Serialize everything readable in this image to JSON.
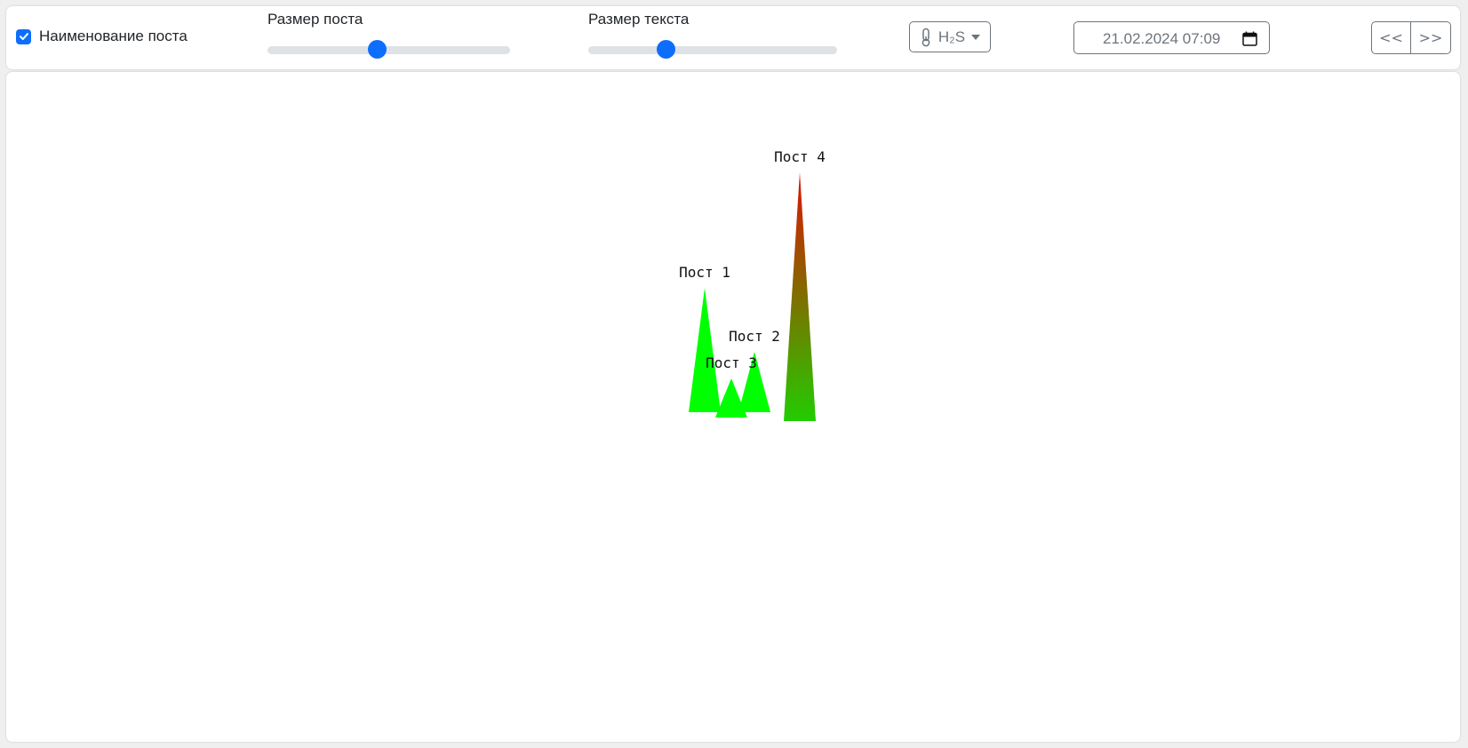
{
  "toolbar": {
    "show_names": {
      "label": "Наименование поста",
      "checked": true
    },
    "post_size": {
      "label": "Размер поста",
      "value_fraction": 0.45
    },
    "text_size": {
      "label": "Размер текста",
      "value_fraction": 0.31
    },
    "substance": {
      "icon": "thermometer-icon",
      "label": "H₂S"
    },
    "datetime": {
      "value": "21.02.2024 07:09",
      "icon": "calendar-icon"
    },
    "nav": {
      "prev": "<<",
      "next": ">>"
    }
  },
  "map": {
    "posts": [
      {
        "name": "Пост 1",
        "level": 0.35,
        "color_top": "#00ff00",
        "color_bottom": "#00ff00"
      },
      {
        "name": "Пост 2",
        "level": 0.17,
        "color_top": "#00ff00",
        "color_bottom": "#00ff00"
      },
      {
        "name": "Пост 3",
        "level": 0.11,
        "color_top": "#00ff00",
        "color_bottom": "#00ff00"
      },
      {
        "name": "Пост 4",
        "level": 0.7,
        "color_top": "#dd1100",
        "color_bottom": "#22cc00"
      }
    ]
  },
  "colors": {
    "accent": "#0d6efd",
    "border": "#6c757d",
    "track": "#dee2e6"
  }
}
